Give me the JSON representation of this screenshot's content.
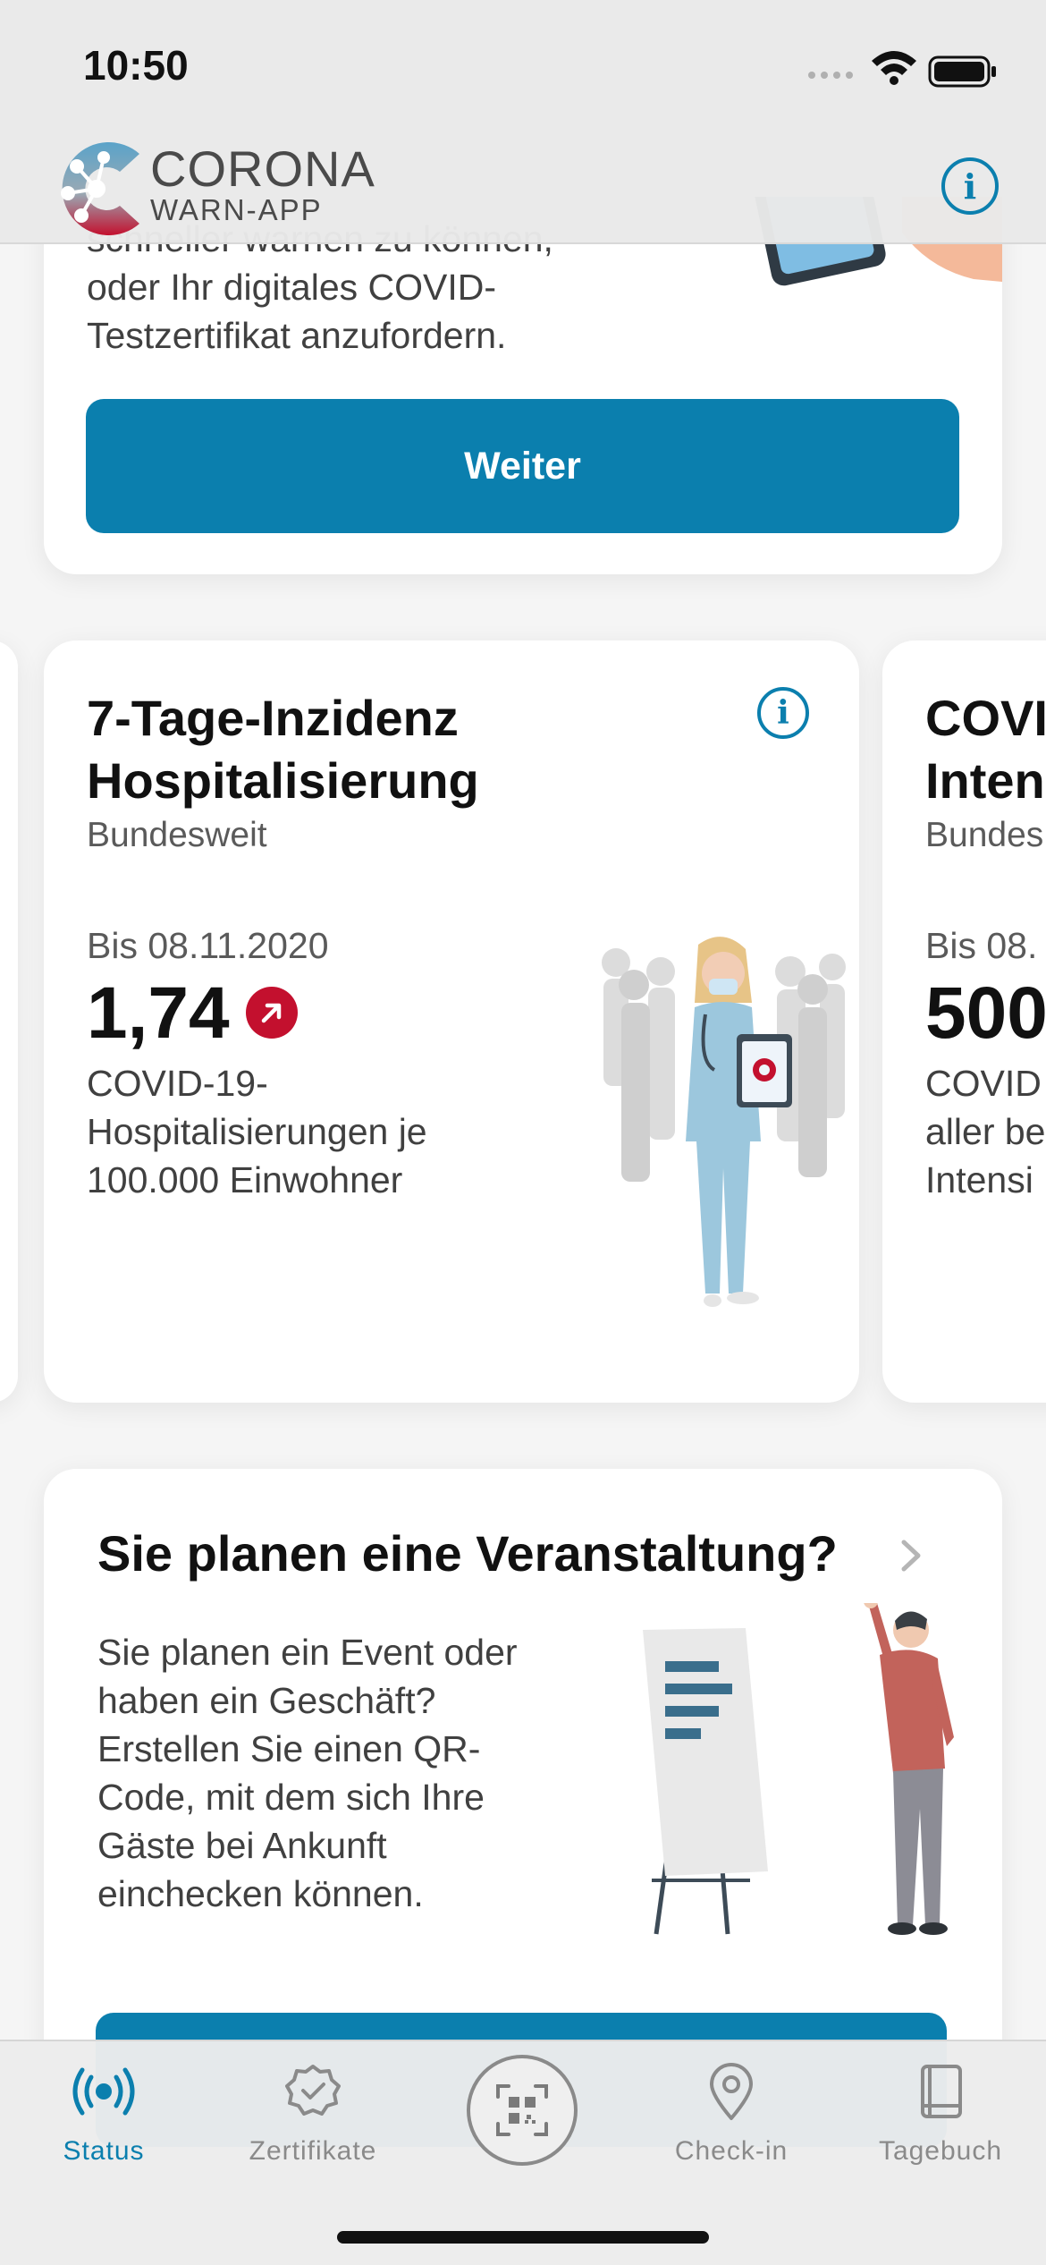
{
  "status_bar": {
    "time": "10:50"
  },
  "header": {
    "logo_title": "CORONA",
    "logo_subtitle": "WARN-APP"
  },
  "top_card": {
    "text_line_1": "schneller warnen zu können,",
    "text_line_2": "oder Ihr digitales COVID-",
    "text_line_3": "Testzertifikat anzufordern.",
    "button_label": "Weiter"
  },
  "statistics": {
    "main": {
      "title_line_1": "7-Tage-Inzidenz",
      "title_line_2": "Hospitalisierung",
      "subtitle": "Bundesweit",
      "date": "Bis 08.11.2020",
      "value": "1,74",
      "desc_line_1": "COVID-19-",
      "desc_line_2": "Hospitalisierungen je",
      "desc_line_3": "100.000 Einwohner"
    },
    "next": {
      "title_line_1": "COVI",
      "title_line_2": "Inten",
      "subtitle": "Bundes",
      "date": "Bis 08.",
      "value": "500",
      "desc_line_1": "COVID",
      "desc_line_2": "aller be",
      "desc_line_3": "Intensi"
    }
  },
  "event_card": {
    "title": "Sie planen eine Veranstaltung?",
    "text_lines": [
      "Sie planen ein Event oder",
      "haben ein Geschäft?",
      "Erstellen Sie einen QR-",
      "Code, mit dem sich Ihre",
      "Gäste bei Ankunft",
      "einchecken können."
    ]
  },
  "tabbar": {
    "tabs": [
      {
        "label": "Status",
        "icon": "status-icon",
        "active": true
      },
      {
        "label": "Zertifikate",
        "icon": "certificate-icon",
        "active": false
      },
      {
        "label": "",
        "icon": "qr-scan-icon",
        "active": false
      },
      {
        "label": "Check-in",
        "icon": "location-pin-icon",
        "active": false
      },
      {
        "label": "Tagebuch",
        "icon": "diary-book-icon",
        "active": false
      }
    ]
  },
  "colors": {
    "accent": "#0b7fae",
    "trend_red": "#c3102e",
    "text_secondary": "#5a5a5a"
  }
}
